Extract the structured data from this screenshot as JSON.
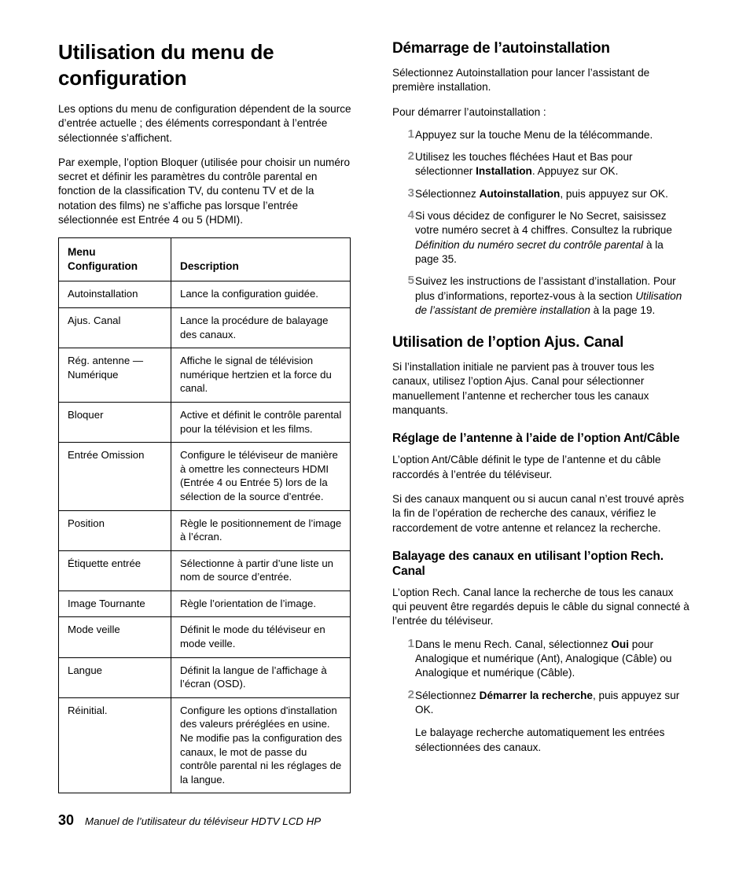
{
  "document": {
    "left_column": {
      "title": "Utilisation du menu de configuration",
      "paragraphs": [
        "Les options du menu de configuration dépendent de la source d’entrée actuelle ; des éléments correspondant à l’entrée sélectionnée s’affichent.",
        "Par exemple, l’option Bloquer (utilisée pour choisir un numéro secret et définir les paramètres du contrôle parental en fonction de la classification TV, du contenu TV et de la notation des films) ne s’affiche pas lorsque l’entrée sélectionnée est Entrée 4 ou 5 (HDMI)."
      ],
      "table": {
        "headers": [
          "Menu Configuration",
          "Description"
        ],
        "header_line1": "Menu",
        "header_line2": "Configuration",
        "rows": [
          {
            "menu": "Autoinstallation",
            "description": "Lance la configuration guidée."
          },
          {
            "menu": "Ajus. Canal",
            "description": "Lance la procédure de balayage des canaux."
          },
          {
            "menu": "Rég. antenne — Numérique",
            "description": "Affiche le signal de télévision numérique hertzien et la force du canal."
          },
          {
            "menu": "Bloquer",
            "description": "Active et définit le contrôle parental pour la télévision et les films."
          },
          {
            "menu": "Entrée Omission",
            "description": "Configure le téléviseur de manière à omettre les connecteurs HDMI (Entrée 4 ou Entrée 5) lors de la sélection de la source d’entrée."
          },
          {
            "menu": "Position",
            "description": "Règle le positionnement de l’image à l’écran."
          },
          {
            "menu": "Étiquette entrée",
            "description": "Sélectionne à partir d’une liste un nom de source d’entrée."
          },
          {
            "menu": "Image Tournante",
            "description": "Règle l’orientation de l’image."
          },
          {
            "menu": "Mode veille",
            "description": "Définit le mode du téléviseur en mode veille."
          },
          {
            "menu": "Langue",
            "description": "Définit la langue de l’affichage à l’écran (OSD)."
          },
          {
            "menu": "Réinitial.",
            "description": "Configure les options d'installation des valeurs préréglées en usine. Ne modifie pas la configuration des canaux, le mot de passe du contrôle parental ni les réglages de la langue."
          }
        ]
      }
    },
    "right_column": {
      "section1": {
        "heading": "Démarrage de l’autoinstallation",
        "intro": "Sélectionnez Autoinstallation pour lancer l’assistant de première installation.",
        "lead_in": "Pour démarrer l’autoinstallation :",
        "steps": [
          {
            "num": "1",
            "parts": [
              {
                "t": "Appuyez sur la touche Menu de la télécommande.",
                "s": "n"
              }
            ]
          },
          {
            "num": "2",
            "parts": [
              {
                "t": "Utilisez les touches fléchées Haut et Bas pour sélectionner ",
                "s": "n"
              },
              {
                "t": "Installation",
                "s": "b"
              },
              {
                "t": ". Appuyez sur OK.",
                "s": "n"
              }
            ]
          },
          {
            "num": "3",
            "parts": [
              {
                "t": "Sélectionnez ",
                "s": "n"
              },
              {
                "t": "Autoinstallation",
                "s": "b"
              },
              {
                "t": ", puis appuyez sur OK.",
                "s": "n"
              }
            ]
          },
          {
            "num": "4",
            "parts": [
              {
                "t": "Si vous décidez de configurer le No Secret, saisissez votre numéro secret à 4 chiffres. Consultez la rubrique ",
                "s": "n"
              },
              {
                "t": "Définition du numéro secret du contrôle parental",
                "s": "i"
              },
              {
                "t": " à la page 35.",
                "s": "n"
              }
            ]
          },
          {
            "num": "5",
            "parts": [
              {
                "t": "Suivez les instructions de l’assistant d’installation. Pour plus d’informations, reportez-vous à la section ",
                "s": "n"
              },
              {
                "t": "Utilisation de l’assistant de première installation",
                "s": "i"
              },
              {
                "t": " à la page 19.",
                "s": "n"
              }
            ]
          }
        ]
      },
      "section2": {
        "heading": "Utilisation de l’option Ajus. Canal",
        "intro": "Si l’installation initiale ne parvient pas à trouver tous les canaux, utilisez l’option Ajus. Canal pour sélectionner manuellement l’antenne et rechercher tous les canaux manquants.",
        "sub1": {
          "heading": "Réglage de l’antenne à l’aide de l’option Ant/Câble",
          "paragraphs": [
            "L’option Ant/Câble définit le type de l’antenne et du câble raccordés à l’entrée du téléviseur.",
            "Si des canaux manquent ou si aucun canal n’est trouvé après la fin de l’opération de recherche des canaux, vérifiez le raccordement de votre antenne et relancez la recherche."
          ]
        },
        "sub2": {
          "heading": "Balayage des canaux en utilisant l’option Rech. Canal",
          "intro": "L’option Rech. Canal lance la recherche de tous les canaux qui peuvent être regardés depuis le câble du signal connecté à l’entrée du téléviseur.",
          "steps": [
            {
              "num": "1",
              "parts": [
                {
                  "t": "Dans le menu Rech. Canal, sélectionnez ",
                  "s": "n"
                },
                {
                  "t": "Oui",
                  "s": "b"
                },
                {
                  "t": " pour Analogique et numérique (Ant), Analogique (Câble) ou Analogique et numérique (Câble).",
                  "s": "n"
                }
              ]
            },
            {
              "num": "2",
              "parts": [
                {
                  "t": "Sélectionnez ",
                  "s": "n"
                },
                {
                  "t": "Démarrer la recherche",
                  "s": "b"
                },
                {
                  "t": ", puis appuyez sur OK.",
                  "s": "n"
                }
              ],
              "note": "Le balayage recherche automatiquement les entrées sélectionnées des canaux."
            }
          ]
        }
      }
    },
    "footer": {
      "page_number": "30",
      "text": "Manuel de l’utilisateur du téléviseur HDTV LCD HP"
    }
  },
  "colors": {
    "text": "#000000",
    "step_number": "#8c8c8c",
    "table_border": "#000000",
    "background": "#ffffff"
  }
}
